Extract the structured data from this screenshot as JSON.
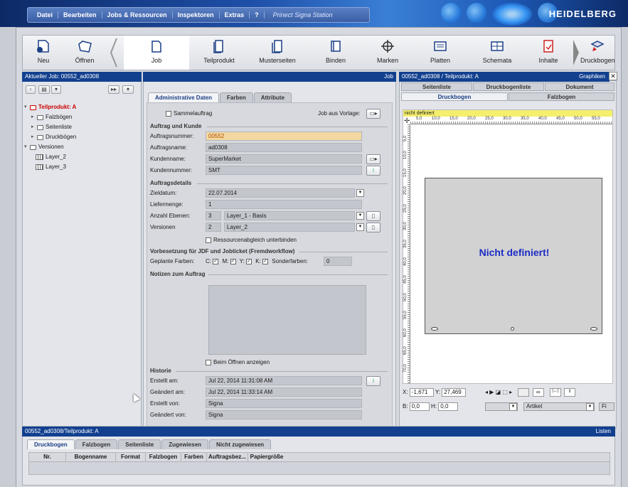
{
  "menubar": {
    "items": [
      "Datei",
      "Bearbeiten",
      "Jobs & Ressourcen",
      "Inspektoren",
      "Extras",
      "?"
    ],
    "app_title": "Prinect Signa Station",
    "brand": "HEIDELBERG"
  },
  "toolbar": {
    "neu": "Neu",
    "oeffnen": "Öffnen",
    "job": "Job",
    "teilprodukt": "Teilprodukt",
    "musterseiten": "Musterseiten",
    "binden": "Binden",
    "marken": "Marken",
    "platten": "Platten",
    "schemata": "Schemata",
    "inhalte": "Inhalte",
    "druckbogen": "Druckbogen"
  },
  "left_panel": {
    "title": "Aktueller Job: 00552_ad0308",
    "tree": {
      "teilprodukt": "Teilprodukt: A",
      "falzboegen": "Falzbögen",
      "seitenliste": "Seitenliste",
      "druckboegen": "Druckbögen",
      "versionen": "Versionen",
      "layer2": "Layer_2",
      "layer3": "Layer_3"
    }
  },
  "mid_panel": {
    "title": "Job",
    "tabs": [
      "Administrative Daten",
      "Farben",
      "Attribute"
    ],
    "sammelauftrag": "Sammelauftrag",
    "job_aus_vorlage": "Job aus Vorlage:",
    "sect_auftrag": "Auftrag und Kunde",
    "auftragsnummer_label": "Auftragsnummer:",
    "auftragsnummer": "00552",
    "auftragsname_label": "Auftragsname:",
    "auftragsname": "ad0308",
    "kundenname_label": "Kundenname:",
    "kundenname": "SuperMarket",
    "kundennummer_label": "Kundennummer:",
    "kundennummer": "SMT",
    "sect_details": "Auftragsdetails",
    "zieldatum_label": "Zieldatum:",
    "zieldatum": "22.07.2014",
    "liefermenge_label": "Liefermenge:",
    "liefermenge": "1",
    "anzahl_ebenen_label": "Anzahl Ebenen:",
    "anzahl_ebenen": "3",
    "ebene_select": "Layer_1 - Basis",
    "versionen_label": "Versionen",
    "versionen": "2",
    "version_select": "Layer_2",
    "ressourcenabgleich": "Ressourcenabgleich unterbinden",
    "sect_vorbesetzung": "Vorbesetzung für JDF und Jobticket (Fremdworkflow)",
    "geplante_farben_label": "Geplante Farben:",
    "farbe_c": "C:",
    "farbe_m": "M:",
    "farbe_y": "Y:",
    "farbe_k": "K:",
    "sonderfarben_label": "Sonderfarben:",
    "sonderfarben": "0",
    "sect_notizen": "Notizen zum Auftrag",
    "beim_oeffnen": "Beim Öffnen anzeigen",
    "sect_historie": "Historie",
    "erstellt_am_label": "Erstellt am:",
    "erstellt_am": "Jul 22, 2014  11:31:08 AM",
    "geaendert_am_label": "Geändert am:",
    "geaendert_am": "Jul 22, 2014  11:33:14 AM",
    "erstellt_von_label": "Erstellt von:",
    "erstellt_von": "Signa",
    "geaendert_von_label": "Geändert von:",
    "geaendert_von": "Signa"
  },
  "right_panel": {
    "title": "00552_ad0308 / Teilprodukt: A",
    "graphiken": "Graphiken",
    "tabs_row1": [
      "Seitenliste",
      "Druckbogenliste",
      "Dokument"
    ],
    "tabs_row2": [
      "Druckbogen",
      "Falzbogen"
    ],
    "nicht_definiert_bar": "nicht definiert",
    "ruler_h": [
      "5,0",
      "10,0",
      "15,0",
      "20,0",
      "25,0",
      "30,0",
      "35,0",
      "40,0",
      "45,0",
      "50,0",
      "55,0"
    ],
    "ruler_v": [
      "5,0",
      "10,0",
      "15,0",
      "20,0",
      "25,0",
      "30,0",
      "35,0",
      "40,0",
      "45,0",
      "50,0",
      "55,0",
      "60,0",
      "65,0",
      "70,0"
    ],
    "sheet_text": "Nicht definiert!",
    "x_label": "X:",
    "x_value": "-1,671",
    "y_label": "Y:",
    "y_value": "27,469",
    "b_label": "B:",
    "b_value": "0,0",
    "h_label": "H:",
    "h_value": "0,0",
    "artikel": "Artikel",
    "f_label": "Fi"
  },
  "bottom_panel": {
    "title": "00552_ad0308/Teilprodukt: A",
    "listen": "Listen",
    "tabs": [
      "Druckbogen",
      "Falzbogen",
      "Seitenliste",
      "Zugewiesen",
      "Nicht zugewiesen"
    ],
    "columns": [
      "Nr.",
      "Bogenname",
      "Format",
      "Falzbogen",
      "Farben",
      "Auftragsbez...",
      "Papiergröße"
    ]
  }
}
